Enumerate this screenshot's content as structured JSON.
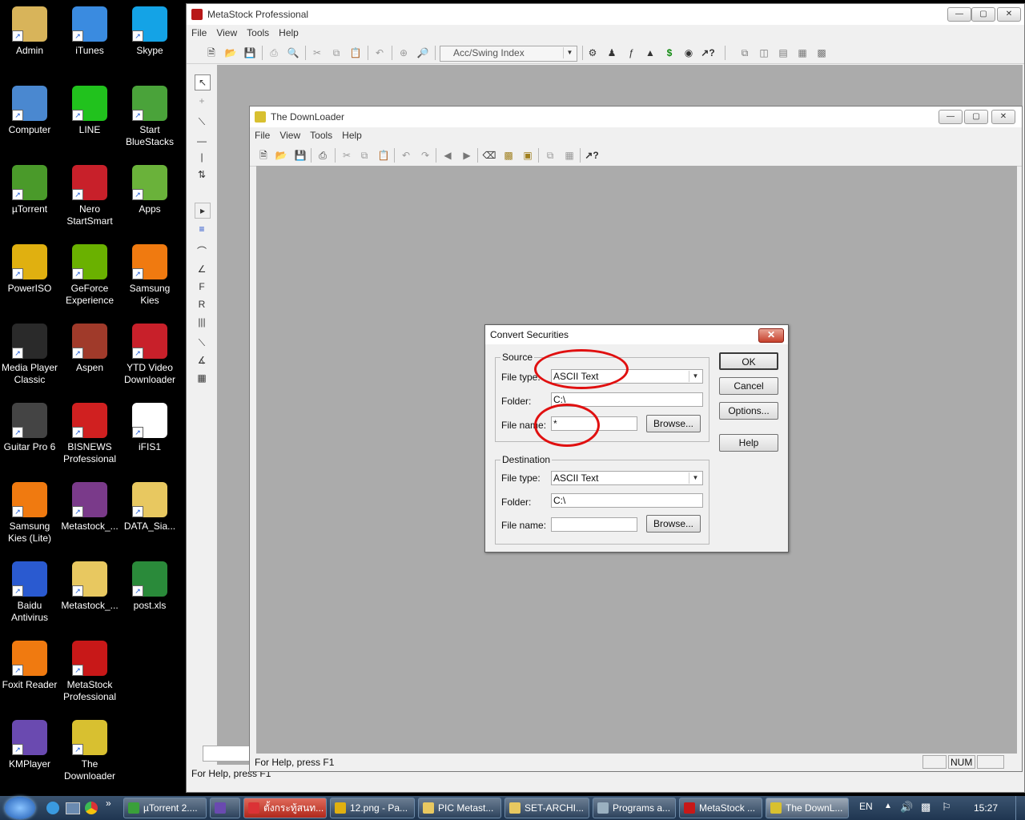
{
  "desktop": {
    "icons": [
      {
        "label": "Admin",
        "name": "admin-icon",
        "color": "#d8b45a"
      },
      {
        "label": "iTunes",
        "name": "itunes-icon",
        "color": "#3a8be0"
      },
      {
        "label": "Skype",
        "name": "skype-icon",
        "color": "#14a3e6"
      },
      {
        "label": "Computer",
        "name": "computer-icon",
        "color": "#4a88d0"
      },
      {
        "label": "LINE",
        "name": "line-icon",
        "color": "#21c21d"
      },
      {
        "label": "Start BlueStacks",
        "name": "bluestacks-icon",
        "color": "#4aa33a"
      },
      {
        "label": "µTorrent",
        "name": "utorrent-icon",
        "color": "#4a9a2a"
      },
      {
        "label": "Nero StartSmart",
        "name": "nero-icon",
        "color": "#c8202a"
      },
      {
        "label": "Apps",
        "name": "apps-icon",
        "color": "#6ab23a"
      },
      {
        "label": "PowerISO",
        "name": "poweriso-icon",
        "color": "#e0b010"
      },
      {
        "label": "GeForce Experience",
        "name": "geforce-icon",
        "color": "#6ab100"
      },
      {
        "label": "Samsung Kies",
        "name": "samsung-kies-icon",
        "color": "#f07a10"
      },
      {
        "label": "Media Player Classic",
        "name": "media-player-classic-icon",
        "color": "#2a2a2a"
      },
      {
        "label": "Aspen",
        "name": "aspen-icon",
        "color": "#a03a2a"
      },
      {
        "label": "YTD Video Downloader",
        "name": "ytd-icon",
        "color": "#c8202a"
      },
      {
        "label": "Guitar Pro 6",
        "name": "guitar-pro-icon",
        "color": "#444444"
      },
      {
        "label": "BISNEWS Professional",
        "name": "bisnews-icon",
        "color": "#d02020"
      },
      {
        "label": "iFIS1",
        "name": "ifis-icon",
        "color": "#ffffff"
      },
      {
        "label": "Samsung Kies (Lite)",
        "name": "samsung-kies-lite-icon",
        "color": "#f07a10"
      },
      {
        "label": "Metastock_...",
        "name": "winrar-icon",
        "color": "#7a3a8a"
      },
      {
        "label": "DATA_Sia...",
        "name": "folder-icon",
        "color": "#e8c860"
      },
      {
        "label": "Baidu Antivirus",
        "name": "baidu-antivirus-icon",
        "color": "#2a5ad0"
      },
      {
        "label": "Metastock_...",
        "name": "folder-icon",
        "color": "#e8c860"
      },
      {
        "label": "post.xls",
        "name": "excel-file-icon",
        "color": "#2a8a3a"
      },
      {
        "label": "Foxit Reader",
        "name": "foxit-icon",
        "color": "#f07a10"
      },
      {
        "label": "MetaStock Professional",
        "name": "metastock-icon",
        "color": "#c81818"
      },
      {
        "label": "",
        "name": "empty-slot",
        "color": "#000000"
      },
      {
        "label": "KMPlayer",
        "name": "kmplayer-icon",
        "color": "#6a4ab0"
      },
      {
        "label": "The Downloader",
        "name": "downloader-icon",
        "color": "#d8c030"
      }
    ]
  },
  "metastock": {
    "title": "MetaStock Professional",
    "menu": [
      "File",
      "View",
      "Tools",
      "Help"
    ],
    "indicator": "Acc/Swing Index",
    "status": "For Help, press F1"
  },
  "downloader": {
    "title": "The DownLoader",
    "menu": [
      "File",
      "View",
      "Tools",
      "Help"
    ],
    "status": "For Help, press F1",
    "num": "NUM"
  },
  "dialog": {
    "title": "Convert Securities",
    "source_label": "Source",
    "dest_label": "Destination",
    "file_type_label": "File type:",
    "folder_label": "Folder:",
    "file_name_label": "File name:",
    "source": {
      "file_type": "ASCII Text",
      "folder": "C:\\",
      "file_name": "*"
    },
    "dest": {
      "file_type": "ASCII Text",
      "folder": "C:\\",
      "file_name": ""
    },
    "browse": "Browse...",
    "ok": "OK",
    "cancel": "Cancel",
    "options": "Options...",
    "help": "Help"
  },
  "taskbar": {
    "tasks": [
      "µTorrent 2....",
      "",
      "ตั้งกระทู้สนท...",
      "12.png - Pa...",
      "PIC Metast...",
      "SET-ARCHI...",
      "Programs a...",
      "MetaStock ...",
      "The DownL..."
    ],
    "lang": "EN",
    "clock": "15:27"
  },
  "colors": {
    "highlight": "#e01010"
  }
}
